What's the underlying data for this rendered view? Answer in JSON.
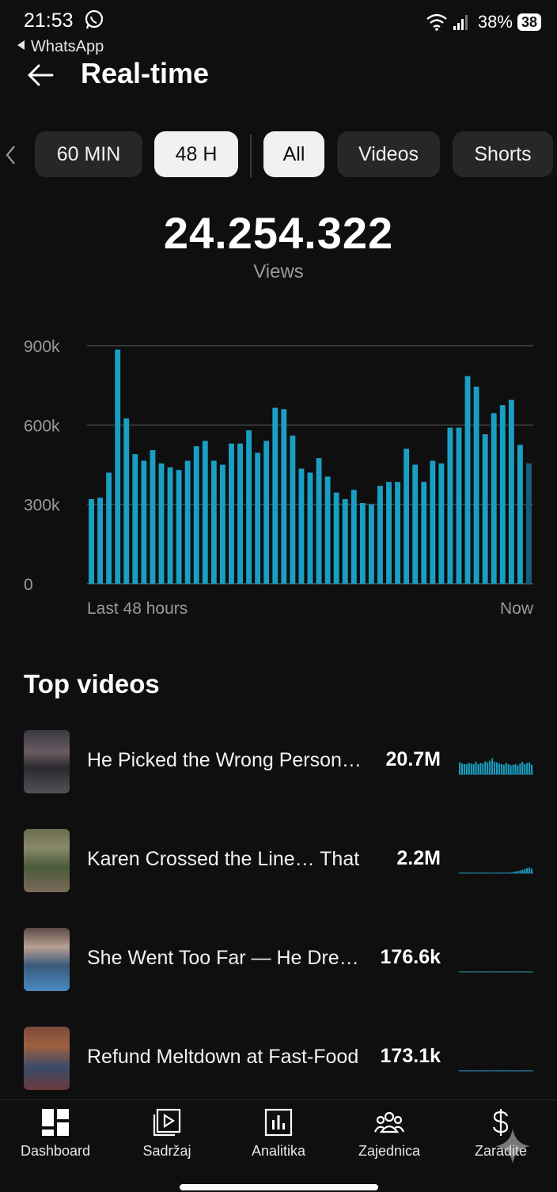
{
  "status_bar": {
    "time": "21:53",
    "back_app": "WhatsApp",
    "battery_percent": "38%",
    "battery_badge": "38"
  },
  "header": {
    "title": "Real-time",
    "back_icon": "arrow-left-icon"
  },
  "filters": {
    "time": [
      {
        "label": "60 MIN",
        "active": false
      },
      {
        "label": "48 H",
        "active": true
      }
    ],
    "type": [
      {
        "label": "All",
        "active": true
      },
      {
        "label": "Videos",
        "active": false
      },
      {
        "label": "Shorts",
        "active": false
      }
    ]
  },
  "summary": {
    "total": "24.254.322",
    "label": "Views"
  },
  "chart_data": {
    "type": "bar",
    "y_ticks": [
      "900k",
      "600k",
      "300k",
      "0"
    ],
    "ylim": [
      0,
      900000
    ],
    "x_start_label": "Last 48 hours",
    "x_end_label": "Now",
    "bar_color": "#1a9fc4",
    "values": [
      320000,
      325000,
      420000,
      885000,
      625000,
      490000,
      465000,
      505000,
      455000,
      440000,
      430000,
      465000,
      520000,
      540000,
      465000,
      450000,
      530000,
      530000,
      580000,
      495000,
      540000,
      665000,
      660000,
      560000,
      435000,
      420000,
      475000,
      405000,
      345000,
      320000,
      355000,
      305000,
      300000,
      370000,
      385000,
      385000,
      510000,
      450000,
      385000,
      465000,
      455000,
      590000,
      590000,
      785000,
      745000,
      565000,
      645000,
      675000,
      695000,
      525000,
      455000
    ]
  },
  "top_videos": {
    "title": "Top videos",
    "items": [
      {
        "title": "He Picked the Wrong Person…",
        "views": "20.7M",
        "spark": [
          0.42,
          0.38,
          0.36,
          0.36,
          0.4,
          0.38,
          0.36,
          0.44,
          0.36,
          0.4,
          0.38,
          0.46,
          0.42,
          0.48,
          0.56,
          0.44,
          0.42,
          0.38,
          0.36,
          0.34,
          0.4,
          0.36,
          0.32,
          0.34,
          0.36,
          0.32,
          0.38,
          0.44,
          0.36,
          0.4,
          0.42,
          0.34
        ]
      },
      {
        "title": "Karen Crossed the Line… That",
        "views": "2.2M",
        "spark": [
          0.01,
          0.01,
          0.01,
          0.01,
          0.01,
          0.01,
          0.01,
          0.01,
          0.01,
          0.01,
          0.01,
          0.01,
          0.01,
          0.01,
          0.01,
          0.01,
          0.01,
          0.01,
          0.01,
          0.01,
          0.01,
          0.02,
          0.03,
          0.04,
          0.06,
          0.08,
          0.1,
          0.12,
          0.15,
          0.18,
          0.2,
          0.16
        ]
      },
      {
        "title": "She Went Too Far — He Drew the Line",
        "views": "176.6k",
        "spark": [
          0.01,
          0.01,
          0.01,
          0.01,
          0.01,
          0.01,
          0.01,
          0.01,
          0.01,
          0.01,
          0.01,
          0.01,
          0.01,
          0.01,
          0.01,
          0.01,
          0.01,
          0.01,
          0.01,
          0.01,
          0.01,
          0.01,
          0.01,
          0.01,
          0.01,
          0.01,
          0.01,
          0.01,
          0.01,
          0.01,
          0.01,
          0.01
        ]
      },
      {
        "title": "Refund Meltdown at Fast-Food",
        "views": "173.1k",
        "spark": [
          0.01,
          0.01,
          0.01,
          0.01,
          0.01,
          0.01,
          0.01,
          0.01,
          0.01,
          0.01,
          0.01,
          0.01,
          0.01,
          0.01,
          0.01,
          0.01,
          0.01,
          0.01,
          0.01,
          0.01,
          0.01,
          0.01,
          0.01,
          0.01,
          0.01,
          0.01,
          0.01,
          0.01,
          0.02,
          0.02,
          0.02,
          0.02
        ]
      }
    ]
  },
  "bottom_nav": [
    {
      "label": "Dashboard",
      "icon": "dashboard-icon"
    },
    {
      "label": "Sadržaj",
      "icon": "content-icon"
    },
    {
      "label": "Analitika",
      "icon": "analytics-icon"
    },
    {
      "label": "Zajednica",
      "icon": "community-icon"
    },
    {
      "label": "Zaradite",
      "icon": "earn-icon"
    }
  ]
}
